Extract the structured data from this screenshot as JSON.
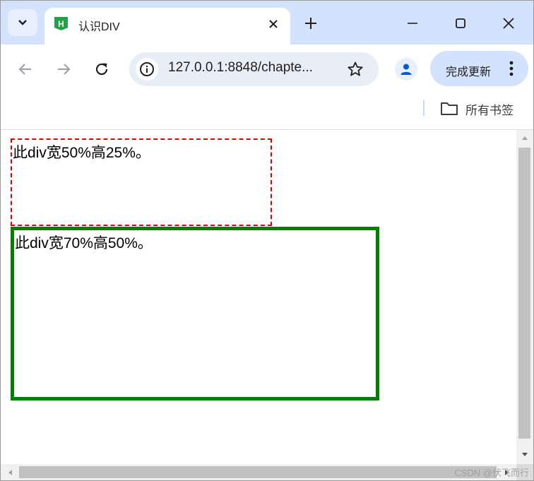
{
  "tab": {
    "favicon_letter": "H",
    "title": "认识DIV"
  },
  "toolbar": {
    "url": "127.0.0.1:8848/chapte...",
    "update_label": "完成更新"
  },
  "bookmarks": {
    "all_bookmarks_label": "所有书签"
  },
  "content": {
    "box1_text": "此div宽50%高25%。",
    "box2_text": "此div宽70%高50%。"
  },
  "watermark": "CSDN @伏飞而行",
  "colors": {
    "tabstrip": "#d3e3fd",
    "box1_border": "#e00000",
    "box2_border": "#008000",
    "favicon": "#22a14a",
    "profile_icon": "#0b57d0"
  },
  "icons": {
    "tab_search": "chevron-down-icon",
    "tab_close": "close-icon",
    "new_tab": "plus-icon",
    "minimize": "minimize-icon",
    "maximize": "maximize-icon",
    "close_window": "close-icon",
    "back": "back-arrow-icon",
    "forward": "forward-arrow-icon",
    "reload": "reload-icon",
    "site_info": "info-icon",
    "bookmark": "star-icon",
    "profile": "person-icon",
    "menu": "kebab-menu-icon",
    "folder": "folder-icon"
  }
}
